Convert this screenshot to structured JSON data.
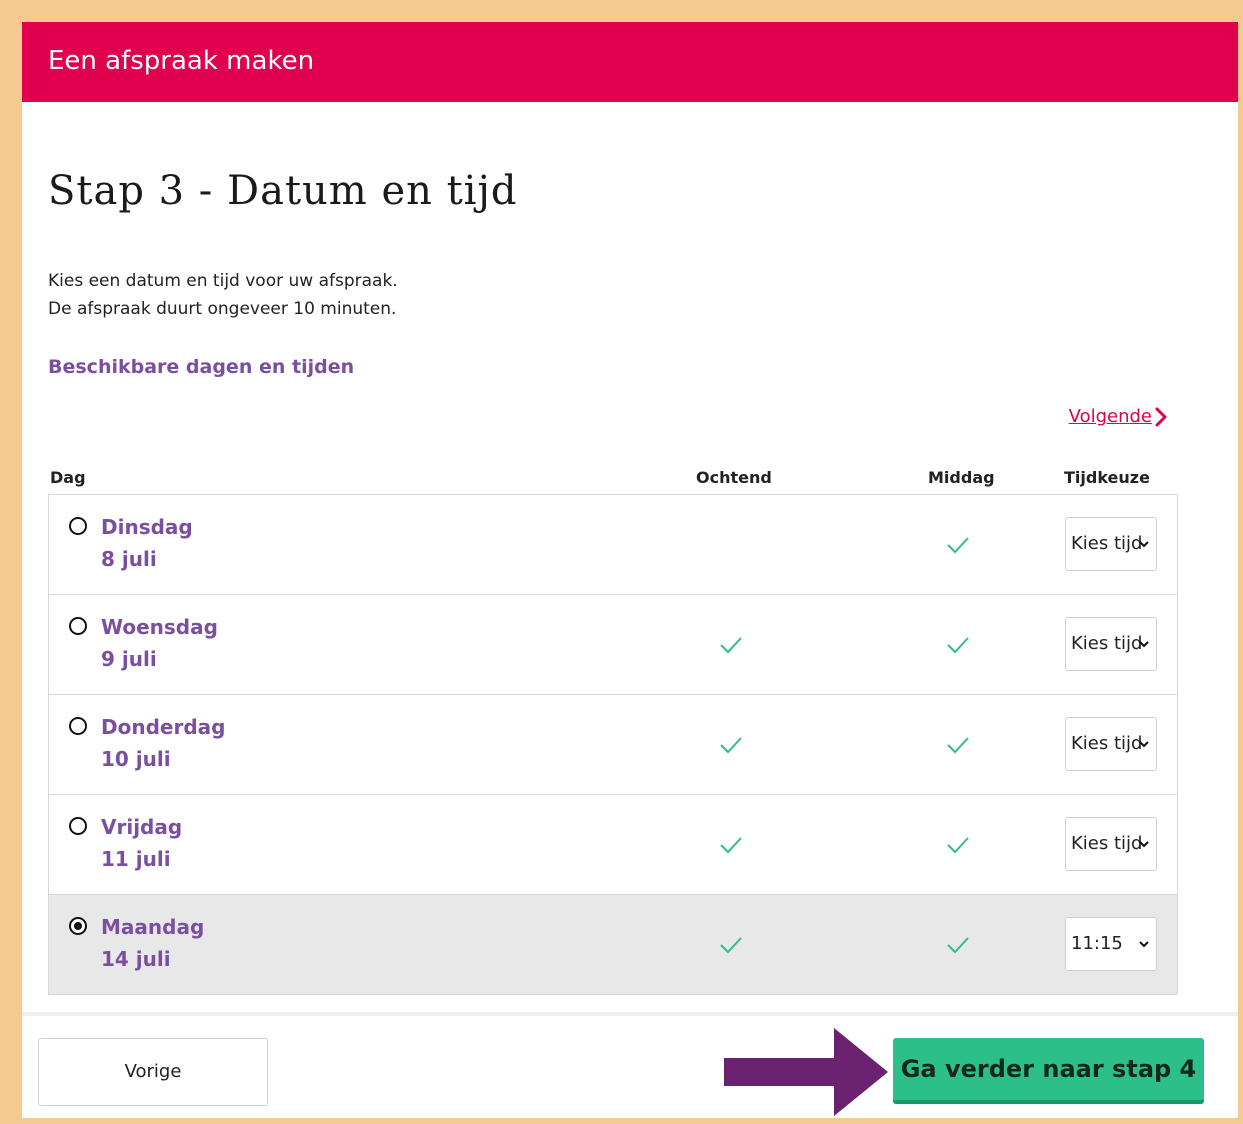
{
  "header": {
    "title": "Een afspraak maken"
  },
  "step": {
    "title": "Stap 3 - Datum en tijd"
  },
  "intro": {
    "line1": "Kies een datum en tijd voor uw afspraak.",
    "line2": "De afspraak duurt ongeveer 10 minuten."
  },
  "availability": {
    "heading": "Beschikbare dagen en tijden"
  },
  "pagination": {
    "next_label": "Volgende"
  },
  "table": {
    "headers": {
      "day": "Dag",
      "morning": "Ochtend",
      "afternoon": "Middag",
      "choice": "Tijdkeuze"
    },
    "rows": [
      {
        "day": "Dinsdag",
        "date": "8 juli",
        "morning": false,
        "afternoon": true,
        "time": "Kies tijd",
        "selected": false
      },
      {
        "day": "Woensdag",
        "date": "9 juli",
        "morning": true,
        "afternoon": true,
        "time": "Kies tijd",
        "selected": false
      },
      {
        "day": "Donderdag",
        "date": "10 juli",
        "morning": true,
        "afternoon": true,
        "time": "Kies tijd",
        "selected": false
      },
      {
        "day": "Vrijdag",
        "date": "11 juli",
        "morning": true,
        "afternoon": true,
        "time": "Kies tijd",
        "selected": false
      },
      {
        "day": "Maandag",
        "date": "14 juli",
        "morning": true,
        "afternoon": true,
        "time": "11:15",
        "selected": true
      }
    ]
  },
  "footer": {
    "prev_label": "Vorige",
    "next_label": "Ga verder naar stap 4"
  },
  "colors": {
    "header": "#e0004d",
    "accent_purple": "#7b4fa0",
    "check_green": "#2dbf89",
    "primary_button": "#2dbf89",
    "arrow": "#6b2270",
    "frame": "#f5c98f"
  },
  "icons": {
    "next": "chevron-right-icon",
    "check": "check-icon",
    "select": "chevron-down-icon",
    "annotation": "arrow-right-icon"
  }
}
